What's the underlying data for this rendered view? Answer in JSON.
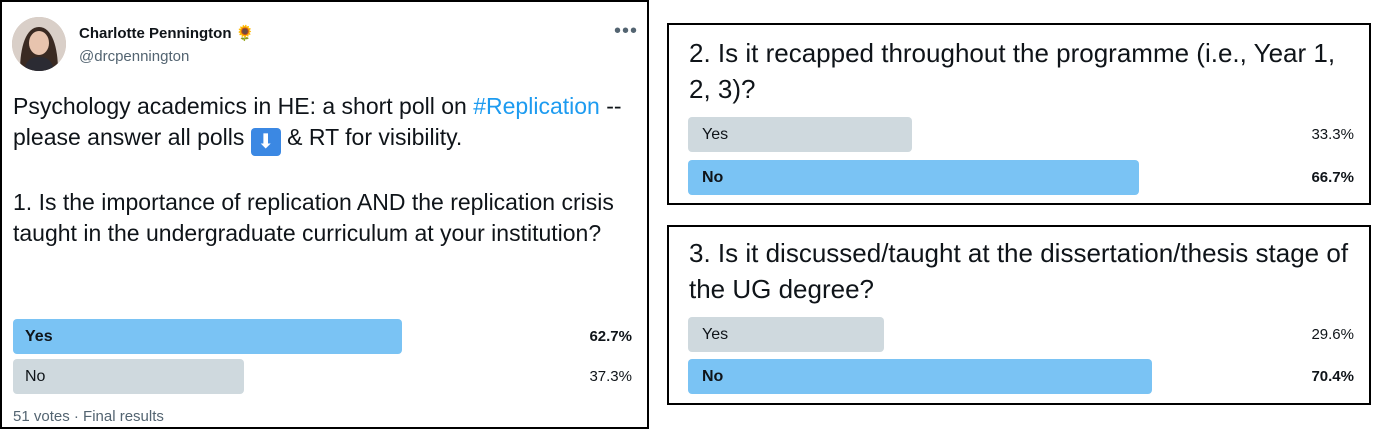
{
  "tweet": {
    "author_name": "Charlotte Pennington",
    "author_emoji": "🌻",
    "handle": "@drcpennington",
    "text_part1": "Psychology academics in HE: a short poll on ",
    "hashtag": "#Replication",
    "text_part2": " -- please answer all polls ",
    "arrow_emoji": "⬇",
    "text_part3": " & RT for visibility.",
    "question": "1. Is the importance of replication AND the replication crisis taught in the undergraduate curriculum at your institution?",
    "options": [
      {
        "label": "Yes",
        "percent": "62.7%",
        "value": 62.7
      },
      {
        "label": "No",
        "percent": "37.3%",
        "value": 37.3
      }
    ],
    "meta": "51 votes · Final results"
  },
  "poll2": {
    "question": "2. Is it recapped throughout the programme (i.e., Year 1, 2, 3)?",
    "options": [
      {
        "label": "Yes",
        "percent": "33.3%",
        "value": 33.3
      },
      {
        "label": "No",
        "percent": "66.7%",
        "value": 66.7
      }
    ]
  },
  "poll3": {
    "question": "3. Is it discussed/taught at the dissertation/thesis stage of the UG degree?",
    "options": [
      {
        "label": "Yes",
        "percent": "29.6%",
        "value": 29.6
      },
      {
        "label": "No",
        "percent": "70.4%",
        "value": 70.4
      }
    ]
  },
  "colors": {
    "winning_bar": "#7ac3f4",
    "losing_bar": "#cfd9de",
    "hashtag": "#1d9bf0"
  },
  "icons": {
    "more": "more-options-icon",
    "arrow": "down-arrow-emoji-icon",
    "author": "sunflower-emoji-icon"
  }
}
